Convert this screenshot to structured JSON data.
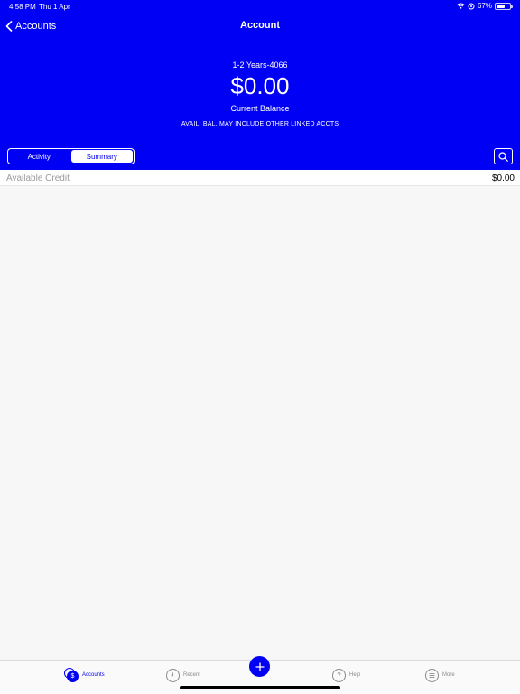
{
  "status_bar": {
    "time": "4:58 PM",
    "date": "Thu 1 Apr",
    "battery_text": "67%",
    "battery_level": 0.67
  },
  "nav": {
    "back_label": "Accounts",
    "title": "Account"
  },
  "account": {
    "name": "1-2 Years-4066",
    "balance": "$0.00",
    "balance_label": "Current Balance",
    "note": "AVAIL. BAL. MAY INCLUDE OTHER LINKED ACCTS"
  },
  "segments": {
    "activity": "Activity",
    "summary": "Summary",
    "selected": "summary"
  },
  "details": [
    {
      "label": "Available Credit",
      "value": "$0.00"
    }
  ],
  "tabs": {
    "accounts": "Accounts",
    "recent": "Recent",
    "help": "Help",
    "more": "More"
  },
  "icons": {
    "back": "chevron-left-icon",
    "search": "search-icon",
    "add": "plus-icon"
  },
  "colors": {
    "brand": "#0000f5",
    "background": "#f7f7f7"
  }
}
